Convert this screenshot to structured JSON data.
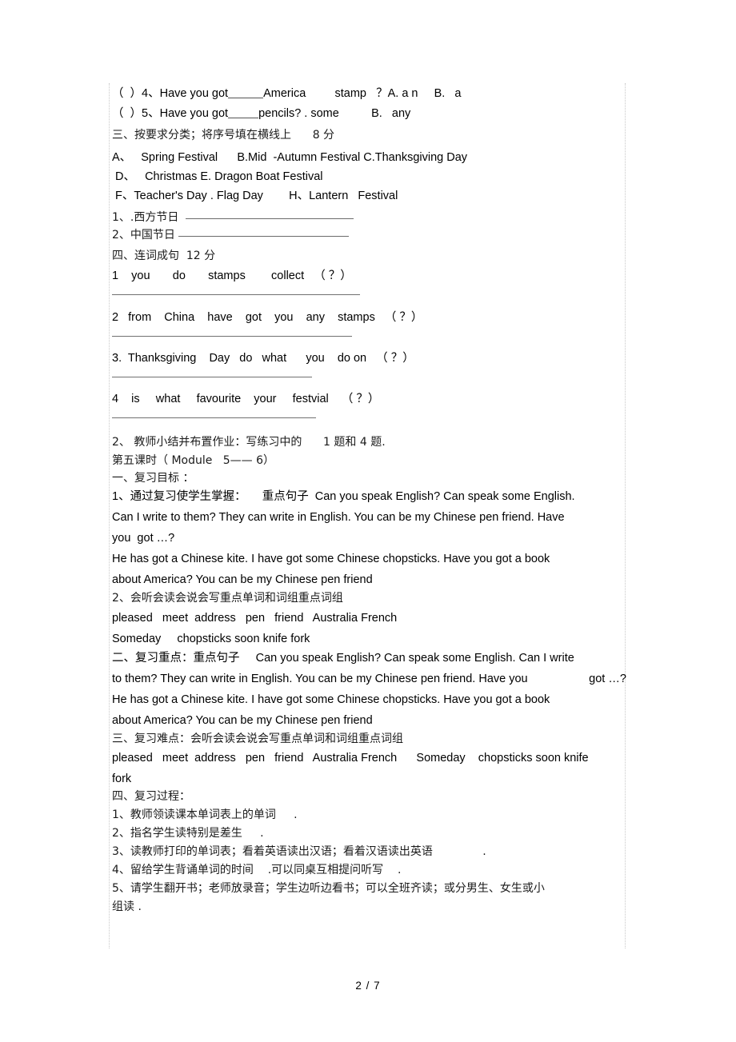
{
  "document": {
    "page_label": "2 / 7",
    "lines": [
      {
        "id": "q4",
        "kind": "en",
        "text_before": "（  ）4、Have you got",
        "blank": "short",
        "text_after": "America         stamp   ？A. a n     B.   a"
      },
      {
        "id": "q5",
        "kind": "en",
        "text_before": "（  ）5、Have you got",
        "blank": "short",
        "text_after": "pencils? . some          B.   any"
      },
      {
        "id": "sec3-title",
        "kind": "cn",
        "text": "三、按要求分类；将序号填在横线上      8 分"
      },
      {
        "id": "opt-abc",
        "kind": "en",
        "text": "A、   Spring Festival      B.Mid  -Autumn Festival C.Thanksgiving Day"
      },
      {
        "id": "opt-de",
        "kind": "en",
        "text": " D、   Christmas E. Dragon Boat Festival"
      },
      {
        "id": "opt-fh",
        "kind": "en",
        "text": " F、Teacher's Day . Flag Day        H、Lantern   Festival"
      },
      {
        "id": "cls-1",
        "kind": "cn",
        "text_before": "1、.西方节日  ",
        "rule_width": 210
      },
      {
        "id": "cls-2",
        "kind": "cn",
        "text_before": "2、中国节日 ",
        "rule_width": 213
      },
      {
        "id": "sec4-title",
        "kind": "cn",
        "text": "四、连词成句  12 分"
      },
      {
        "id": "jumble-1",
        "kind": "en",
        "text": "1    you       do       stamps        collect   （ ？）",
        "rule_width": 310
      },
      {
        "id": "jumble-2",
        "kind": "en",
        "text": "2   from    China    have    got    you    any    stamps   （ ？）",
        "rule_width": 300
      },
      {
        "id": "jumble-3",
        "kind": "en",
        "text": "3.  Thanksgiving    Day   do   what      you    do on   （ ？）",
        "rule_width": 250
      },
      {
        "id": "jumble-4",
        "kind": "en",
        "text": "4    is     what     favourite    your     festvial    （ ？）",
        "rule_width": 255
      },
      {
        "id": "homework",
        "kind": "cn",
        "text": "2、 教师小结并布置作业：写练习中的      1 题和 4 题."
      },
      {
        "id": "lesson5",
        "kind": "cn",
        "text": "第五课时（ Module   5—— 6）"
      },
      {
        "id": "sec1-title",
        "kind": "cn",
        "text": "一、复习目标 ："
      },
      {
        "id": "goal1a",
        "kind": "en",
        "text": "1、通过复习使学生掌握：     重点句子  Can you speak English? Can speak some English."
      },
      {
        "id": "goal1b",
        "kind": "en",
        "text": "Can I write to them? They can write in English. You can be my Chinese pen friend. Have"
      },
      {
        "id": "goal1c",
        "kind": "en",
        "text": "you  got …?"
      },
      {
        "id": "goal1d",
        "kind": "en",
        "text": "He has got a Chinese kite. I have got some Chinese chopsticks. Have you got a book"
      },
      {
        "id": "goal1e",
        "kind": "en",
        "text": "about America? You can be my Chinese pen friend"
      },
      {
        "id": "goal2",
        "kind": "cn",
        "text": "2、会听会读会说会写重点单词和词组重点词组"
      },
      {
        "id": "words1",
        "kind": "en",
        "text": "pleased   meet  address   pen   friend   Australia French"
      },
      {
        "id": "words2",
        "kind": "en",
        "text": "Someday     chopsticks soon knife fork"
      },
      {
        "id": "sec2-title",
        "kind": "en",
        "text": "二、复习重点：重点句子     Can you speak English? Can speak some English. Can I write"
      },
      {
        "id": "sec2-b",
        "kind": "en",
        "text": "to them? They can write in English. You can be my Chinese pen friend. Have you                   got …?"
      },
      {
        "id": "sec2-c",
        "kind": "en",
        "text": "He has got a Chinese kite. I have got some Chinese chopsticks. Have you got a book"
      },
      {
        "id": "sec2-d",
        "kind": "en",
        "text": "about America? You can be my Chinese pen friend"
      },
      {
        "id": "sec3b-title",
        "kind": "cn",
        "text": "三、复习难点：会听会读会说会写重点单词和词组重点词组"
      },
      {
        "id": "words3",
        "kind": "en",
        "text": "pleased   meet  address   pen   friend   Australia French      Someday    chopsticks soon knife"
      },
      {
        "id": "words4",
        "kind": "en",
        "text": "fork"
      },
      {
        "id": "sec4b-title",
        "kind": "cn",
        "text": "四、复习过程："
      },
      {
        "id": "step1",
        "kind": "cn",
        "text": "1、教师领读课本单词表上的单词     ."
      },
      {
        "id": "step2",
        "kind": "cn",
        "text": "2、指名学生读特别是差生     ."
      },
      {
        "id": "step3",
        "kind": "cn",
        "text": "3、读教师打印的单词表；看着英语读出汉语；看着汉语读出英语              ."
      },
      {
        "id": "step4",
        "kind": "cn",
        "text": "4、留给学生背诵单词的时间    .可以同桌互相提问听写    ."
      },
      {
        "id": "step5",
        "kind": "cn",
        "text": "5、请学生翻开书；老师放录音；学生边听边看书；可以全班齐读；或分男生、女生或小"
      },
      {
        "id": "step5b",
        "kind": "cn",
        "text": "组读 ."
      }
    ]
  },
  "colors": {
    "text": "#000000",
    "rule": "#6b6b6b",
    "page_border": "#c8c8c8"
  }
}
